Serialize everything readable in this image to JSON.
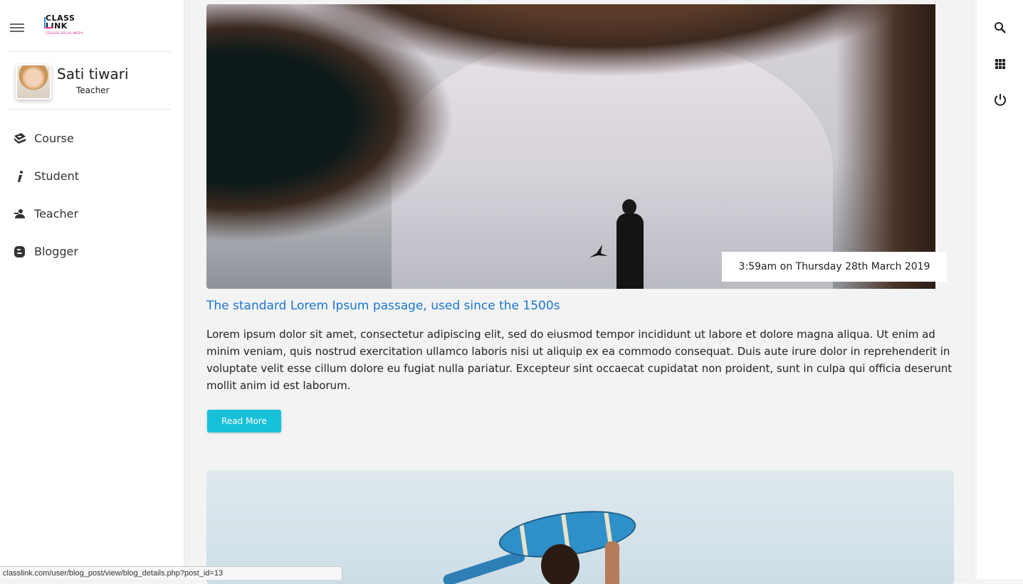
{
  "brand": {
    "line1": "CLASS",
    "line2": "LINK",
    "tagline": "COLLEGE SOCIAL MEDIA"
  },
  "profile": {
    "name": "Sati tiwari",
    "role": "Teacher"
  },
  "nav": {
    "items": [
      {
        "label": "Course",
        "icon": "course-icon"
      },
      {
        "label": "Student",
        "icon": "student-icon"
      },
      {
        "label": "Teacher",
        "icon": "teacher-icon"
      },
      {
        "label": "Blogger",
        "icon": "blogger-icon"
      }
    ]
  },
  "post": {
    "timestamp": "3:59am on Thursday 28th March 2019",
    "title": "The standard Lorem Ipsum passage, used since the 1500s",
    "body": "Lorem ipsum dolor sit amet, consectetur adipiscing elit, sed do eiusmod tempor incididunt ut labore et dolore magna aliqua. Ut enim ad minim veniam, quis nostrud exercitation ullamco laboris nisi ut aliquip ex ea commodo consequat. Duis aute irure dolor in reprehenderit in voluptate velit esse cillum dolore eu fugiat nulla pariatur. Excepteur sint occaecat cupidatat non proident, sunt in culpa qui officia deserunt mollit anim id est laborum.",
    "read_more_label": "Read More"
  },
  "rightbar": {
    "icons": [
      "search-icon",
      "apps-grid-icon",
      "power-icon"
    ]
  },
  "status_url": "classlink.com/user/blog_post/view/blog_details.php?post_id=13",
  "colors": {
    "title_link": "#1976d2",
    "button": "#17c1d9"
  }
}
